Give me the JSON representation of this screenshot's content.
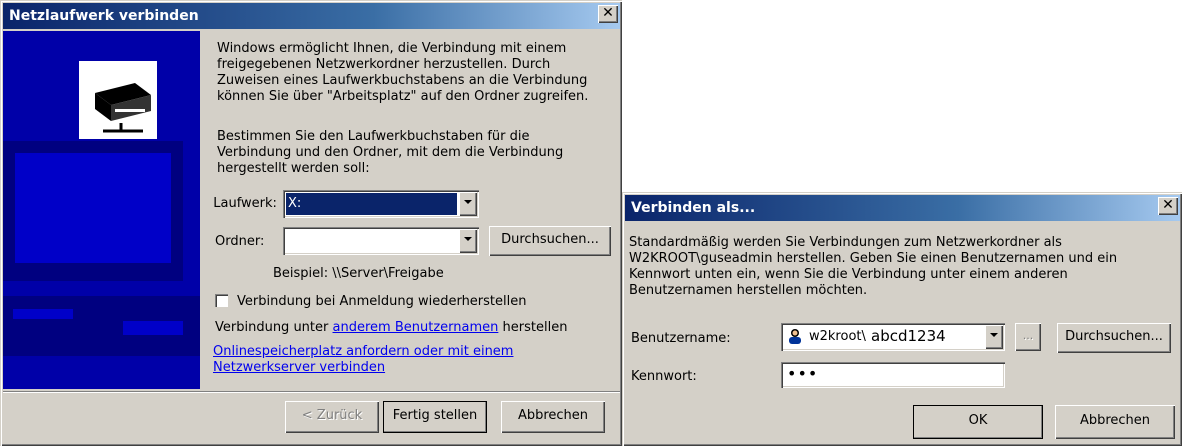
{
  "map_dialog": {
    "title": "Netzlaufwerk verbinden",
    "intro_text": "Windows ermöglicht Ihnen, die Verbindung mit einem freigegebenen Netzwerkordner herzustellen. Durch Zuweisen eines Laufwerkbuchstabens an die Verbindung können Sie über \"Arbeitsplatz\" auf den Ordner zugreifen.",
    "instruction_text": "Bestimmen Sie den Laufwerkbuchstaben für die Verbindung und den Ordner, mit dem die Verbindung hergestellt werden soll:",
    "drive_label": "Laufwerk:",
    "drive_value": "X:",
    "folder_label": "Ordner:",
    "folder_value": "",
    "browse_label": "Durchsuchen...",
    "example_text": "Beispiel: \\\\Server\\Freigabe",
    "reconnect_label": "Verbindung bei Anmeldung wiederherstellen",
    "reconnect_checked": false,
    "connect_as_prefix": "Verbindung unter",
    "connect_as_link": "anderem Benutzernamen",
    "connect_as_suffix": "herstellen",
    "online_storage_link": "Onlinespeicherplatz anfordern oder mit einem Netzwerkserver verbinden",
    "back_label": "< Zurück",
    "finish_label": "Fertig stellen",
    "cancel_label": "Abbrechen",
    "side_panel_color": "#0000a8"
  },
  "connect_as_dialog": {
    "title": "Verbinden als...",
    "description": "Standardmäßig werden Sie Verbindungen zum Netzwerkordner als W2KROOT\\guseadmin herstellen. Geben Sie einen Benutzernamen und ein Kennwort unten ein, wenn Sie die Verbindung unter einem anderen Benutzernamen herstellen möchten.",
    "username_label": "Benutzername:",
    "username_prefix": "w2kroot\\",
    "username_value": "abcd1234",
    "small_button_label": "...",
    "browse_label": "Durchsuchen...",
    "password_label": "Kennwort:",
    "password_value": "•••",
    "ok_label": "OK",
    "cancel_label": "Abbrechen"
  }
}
